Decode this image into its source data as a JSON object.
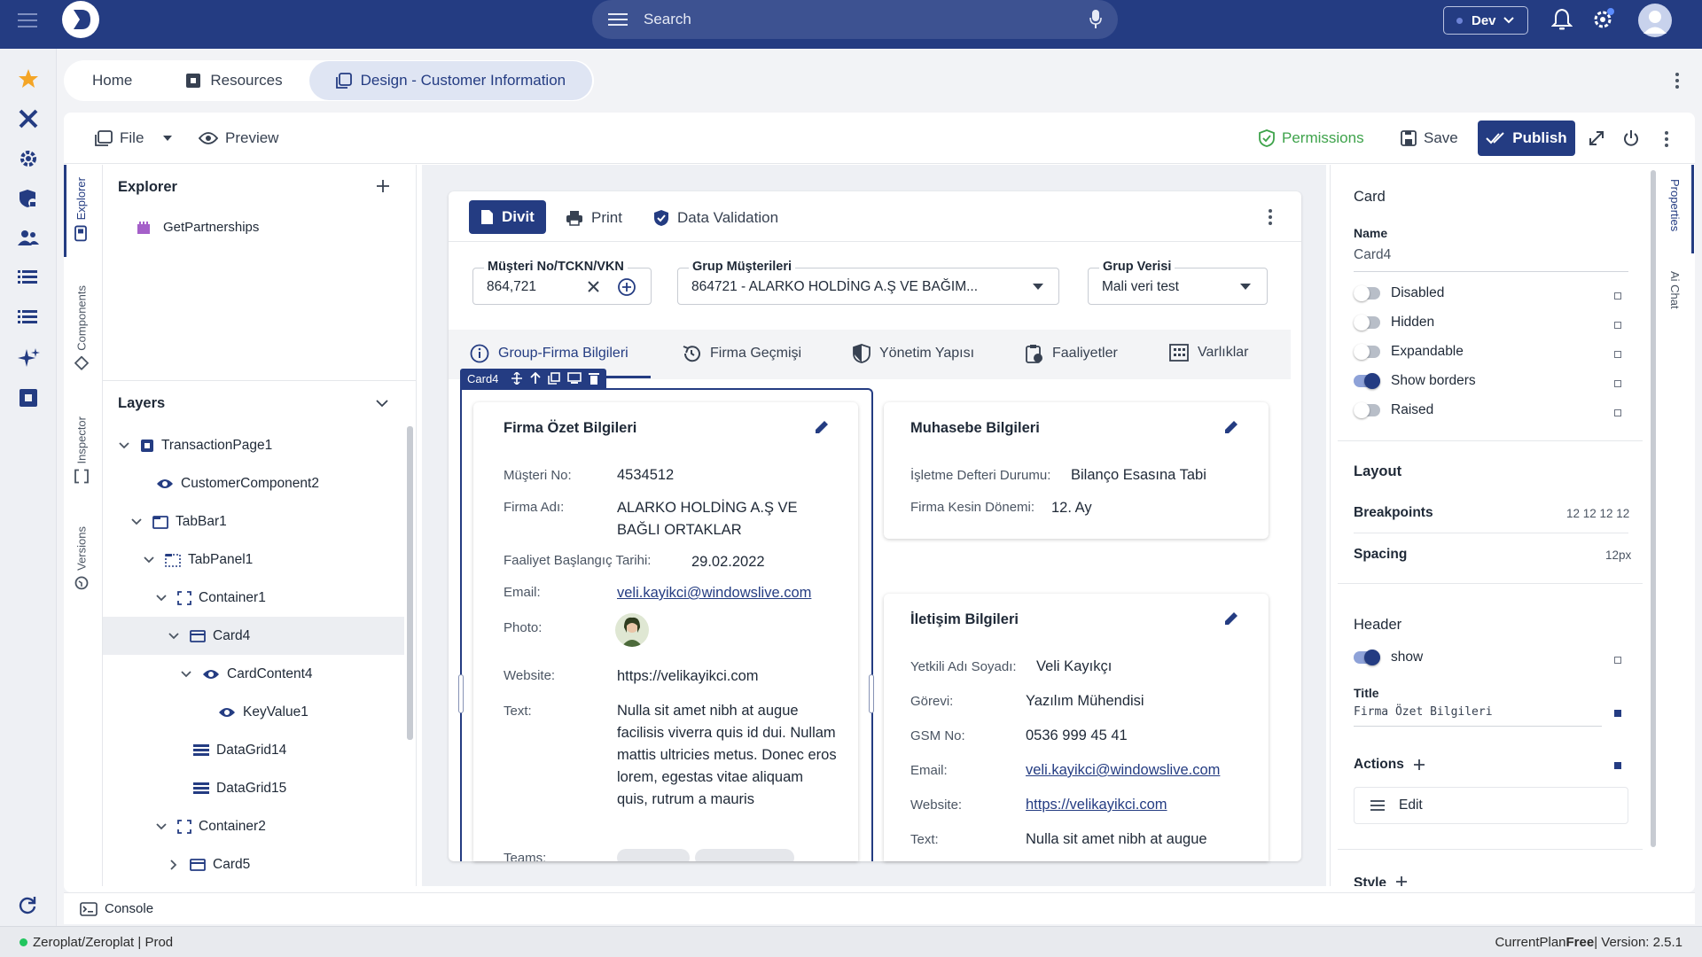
{
  "topbar": {
    "search_placeholder": "Search",
    "env": "Dev"
  },
  "tabs": [
    {
      "label": "Home"
    },
    {
      "label": "Resources"
    },
    {
      "label": "Design - Customer Information"
    }
  ],
  "toolbar": {
    "file": "File",
    "preview": "Preview",
    "permissions": "Permissions",
    "save": "Save",
    "publish": "Publish"
  },
  "side_tabs": {
    "explorer": "Explorer",
    "components": "Components",
    "inspector": "Inspector",
    "versions": "Versions",
    "properties": "Properties",
    "ai_chat": "Ai Chat"
  },
  "explorer": {
    "title": "Explorer",
    "item": "GetPartnerships",
    "layers_title": "Layers",
    "layers": [
      "TransactionPage1",
      "CustomerComponent2",
      "TabBar1",
      "TabPanel1",
      "Container1",
      "Card4",
      "CardContent4",
      "KeyValue1",
      "DataGrid14",
      "DataGrid15",
      "Container2",
      "Card5"
    ]
  },
  "page": {
    "buttons": {
      "divit": "Divit",
      "print": "Print",
      "validation": "Data Validation"
    },
    "fields": {
      "musteri_label": "Müşteri No/TCKN/VKN",
      "musteri_value": "864,721",
      "grup_label": "Grup Müşterileri",
      "grup_value": "864721 - ALARKO HOLDİNG A.Ş VE BAĞIM...",
      "verisi_label": "Grup Verisi",
      "verisi_value": "Mali veri test"
    },
    "tabs": [
      "Group-Firma Bilgileri",
      "Firma Geçmişi",
      "Yönetim Yapısı",
      "Faaliyetler",
      "Varlıklar"
    ],
    "card_tag": "Card4",
    "card1": {
      "title": "Firma Özet Bilgileri",
      "rows": [
        {
          "k": "Müşteri No:",
          "v": "4534512"
        },
        {
          "k": "Firma Adı:",
          "v": "ALARKO HOLDİNG A.Ş VE BAĞLI ORTAKLAR"
        },
        {
          "k": "Faaliyet Başlangıç Tarihi:",
          "v": "29.02.2022"
        },
        {
          "k": "Email:",
          "v": "veli.kayikci@windowslive.com"
        },
        {
          "k": "Photo:",
          "v": ""
        },
        {
          "k": "Website:",
          "v": "https://velikayikci.com"
        },
        {
          "k": "Text:",
          "v": "Nulla sit amet nibh at augue facilisis viverra quis id dui. Nullam mattis ultricies metus. Donec eros lorem, egestas vitae aliquam quis, rutrum a mauris"
        },
        {
          "k": "Teams:",
          "v": ""
        }
      ]
    },
    "card2": {
      "title": "Muhasebe Bilgileri",
      "rows": [
        {
          "k": "İşletme Defteri Durumu:",
          "v": "Bilanço Esasına Tabi"
        },
        {
          "k": "Firma Kesin Dönemi:",
          "v": "12. Ay"
        }
      ]
    },
    "card3": {
      "title": "İletişim Bilgileri",
      "rows": [
        {
          "k": "Yetkili Adı Soyadı:",
          "v": "Veli Kayıkçı"
        },
        {
          "k": "Görevi:",
          "v": "Yazılım Mühendisi"
        },
        {
          "k": "GSM No:",
          "v": "0536 999 45 41"
        },
        {
          "k": "Email:",
          "v": "veli.kayikci@windowslive.com"
        },
        {
          "k": "Website:",
          "v": "https://velikayikci.com"
        },
        {
          "k": "Text:",
          "v": "Nulla sit amet nibh at augue"
        }
      ]
    }
  },
  "props": {
    "section": "Card",
    "name_label": "Name",
    "name_value": "Card4",
    "toggles": [
      {
        "label": "Disabled",
        "on": false
      },
      {
        "label": "Hidden",
        "on": false
      },
      {
        "label": "Expandable",
        "on": false
      },
      {
        "label": "Show borders",
        "on": true
      },
      {
        "label": "Raised",
        "on": false
      }
    ],
    "layout": "Layout",
    "breakpoints_label": "Breakpoints",
    "breakpoints_value": "12 12 12 12",
    "spacing_label": "Spacing",
    "spacing_value": "12px",
    "header": "Header",
    "show": "show",
    "title_label": "Title",
    "title_value": "Firma Özet Bilgileri",
    "actions": "Actions",
    "edit": "Edit",
    "style": "Style"
  },
  "console": "Console",
  "status": {
    "left": "Zeroplat/Zeroplat | Prod",
    "plan_label": "CurrentPlan ",
    "plan_value": "Free",
    "version": " | Version: 2.5.1"
  },
  "colors": {
    "primary": "#243c82",
    "status_dot": "#22c55e"
  }
}
